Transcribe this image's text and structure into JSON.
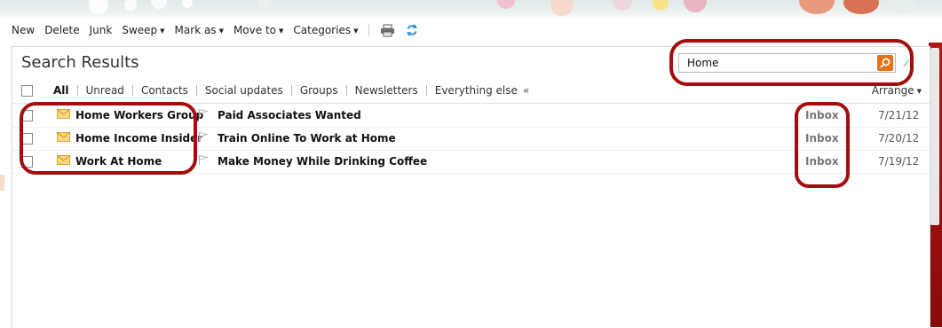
{
  "toolbar": {
    "new_label": "New",
    "delete_label": "Delete",
    "junk_label": "Junk",
    "sweep_label": "Sweep",
    "mark_as_label": "Mark as",
    "move_to_label": "Move to",
    "categories_label": "Categories",
    "print_icon": "printer-icon",
    "refresh_icon": "refresh-icon"
  },
  "panel": {
    "title": "Search Results",
    "search": {
      "value": "Home",
      "icon": "search-icon"
    },
    "filters": {
      "all": "All",
      "unread": "Unread",
      "contacts": "Contacts",
      "social": "Social updates",
      "groups": "Groups",
      "newsletters": "Newsletters",
      "everything_else": "Everything else",
      "collapse": "«"
    },
    "arrange_label": "Arrange"
  },
  "messages": [
    {
      "sender": "Home Workers Group",
      "subject": "Paid Associates Wanted",
      "folder": "Inbox",
      "date": "7/21/12"
    },
    {
      "sender": "Home Income Insider",
      "subject": "Train Online To Work at Home",
      "folder": "Inbox",
      "date": "7/20/12"
    },
    {
      "sender": "Work At Home",
      "subject": "Make Money While Drinking Coffee",
      "folder": "Inbox",
      "date": "7/19/12"
    }
  ],
  "colors": {
    "accent_orange": "#e8701a",
    "annotation_red": "#a30d0d",
    "refresh_blue": "#2a8fd6"
  }
}
